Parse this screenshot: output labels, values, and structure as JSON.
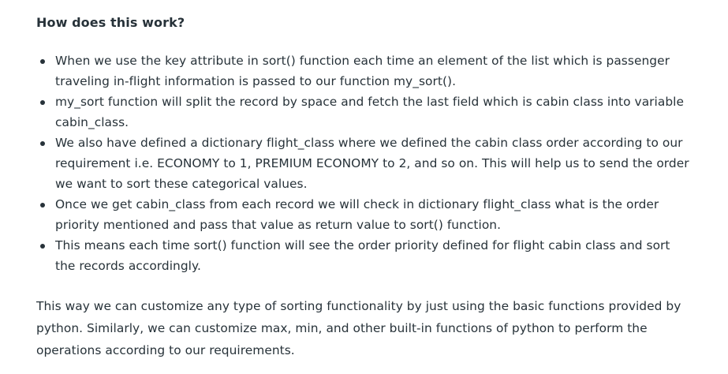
{
  "heading": "How does this work?",
  "points": [
    "When we use the key attribute in sort() function each time an element of the list which is passenger traveling in-flight information is passed to our function my_sort().",
    "my_sort function will split the record by space and fetch the last field which is cabin class into variable cabin_class.",
    "We also have defined a dictionary flight_class where we defined the cabin class order according to our requirement i.e. ECONOMY to 1, PREMIUM ECONOMY to 2, and so on. This will help us to send the order we want to sort these categorical values.",
    "Once we get cabin_class from each record we will check in dictionary flight_class what is the order priority mentioned and pass that value as return value to sort() function.",
    "This means each time sort() function will see the order priority defined for flight cabin class and sort the records accordingly."
  ],
  "closing": "This way we can customize any type of sorting functionality by just using the basic functions provided by python. Similarly, we can customize max, min, and other built-in functions of python to perform the operations according to our requirements."
}
